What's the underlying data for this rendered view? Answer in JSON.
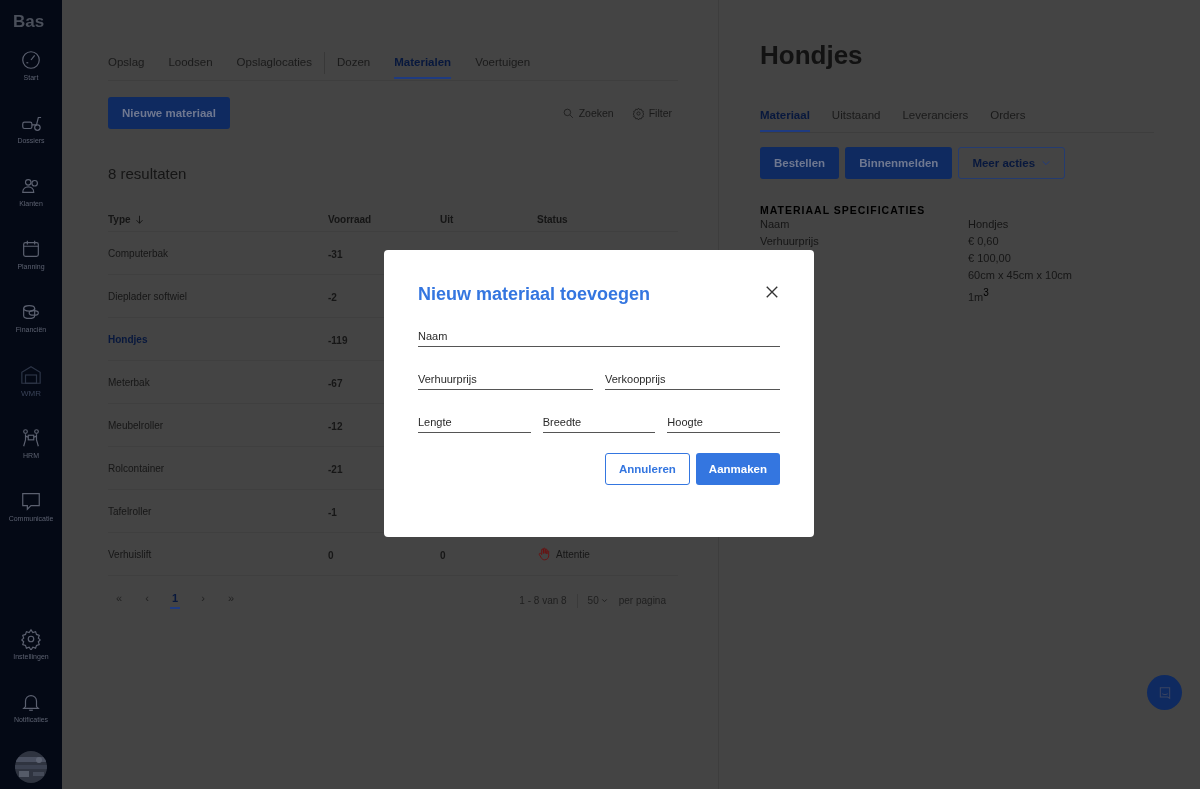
{
  "sidebar": {
    "logo": "Bas",
    "items": [
      {
        "label": "Start",
        "disabled": false
      },
      {
        "label": "Dossiers",
        "disabled": false
      },
      {
        "label": "Klanten",
        "disabled": false
      },
      {
        "label": "Planning",
        "disabled": false
      },
      {
        "label": "Financiën",
        "disabled": false
      },
      {
        "label": "WMR",
        "disabled": true
      },
      {
        "label": "HRM",
        "disabled": false
      },
      {
        "label": "Communicatie",
        "disabled": false
      }
    ],
    "bottom_items": [
      {
        "label": "Instellingen"
      },
      {
        "label": "Notificaties"
      }
    ]
  },
  "tabs": [
    {
      "label": "Opslag",
      "selected": false
    },
    {
      "label": "Loodsen",
      "selected": false
    },
    {
      "label": "Opslaglocaties",
      "selected": false
    },
    {
      "label": "Dozen",
      "selected": false
    },
    {
      "label": "Materialen",
      "selected": true
    },
    {
      "label": "Voertuigen",
      "selected": false
    }
  ],
  "new_button": "Nieuwe materiaal",
  "search": "Zoeken",
  "filter": "Filter",
  "result_count": "8 resultaten",
  "table": {
    "columns": [
      "Type",
      "Voorraad",
      "Uit",
      "Status"
    ],
    "rows": [
      {
        "type": "Computerbak",
        "voorraad": "-31",
        "selected": false
      },
      {
        "type": "Dieplader softwiel",
        "voorraad": "-2",
        "selected": false
      },
      {
        "type": "Hondjes",
        "voorraad": "-119",
        "selected": true
      },
      {
        "type": "Meterbak",
        "voorraad": "-67",
        "selected": false
      },
      {
        "type": "Meubelroller",
        "voorraad": "-12",
        "selected": false
      },
      {
        "type": "Rolcontainer",
        "voorraad": "-21",
        "selected": false
      },
      {
        "type": "Tafelroller",
        "voorraad": "-1",
        "selected": false
      },
      {
        "type": "Verhuislift",
        "voorraad": "0",
        "uit": "0",
        "status": {
          "label": "Attentie",
          "kind": "attention"
        },
        "selected": false
      }
    ]
  },
  "pagination": {
    "first": "«",
    "prev": "‹",
    "pages": [
      {
        "label": "1",
        "selected": true
      }
    ],
    "next": "›",
    "last": "»",
    "range": "1 - 8 van 8",
    "per_page": "50",
    "per_page_label": "per pagina"
  },
  "detail": {
    "title": "Hondjes",
    "tabs": [
      {
        "label": "Materiaal",
        "selected": true
      },
      {
        "label": "Uitstaand",
        "selected": false
      },
      {
        "label": "Leveranciers",
        "selected": false
      },
      {
        "label": "Orders",
        "selected": false
      }
    ],
    "actions": [
      {
        "label": "Bestellen",
        "kind": "primary"
      },
      {
        "label": "Binnenmelden",
        "kind": "primary"
      },
      {
        "label": "Meer acties",
        "kind": "dropdown"
      }
    ],
    "section": "MATERIAAL SPECIFICATIES",
    "specs": [
      {
        "label": "Naam",
        "value": "Hondjes"
      },
      {
        "label": "Verhuurprijs",
        "value": "€ 0,60"
      },
      {
        "value": "€ 100,00"
      },
      {
        "value": "60cm x 45cm x 10cm"
      },
      {
        "value": "1m$^{3}$"
      }
    ]
  },
  "modal": {
    "title": "Nieuw materiaal toevoegen",
    "field_rows": [
      [
        {
          "placeholder": "Naam"
        }
      ],
      [
        {
          "placeholder": "Verhuurprijs"
        },
        {
          "placeholder": "Verkoopprijs"
        }
      ],
      [
        {
          "placeholder": "Lengte"
        },
        {
          "placeholder": "Breedte"
        },
        {
          "placeholder": "Hoogte"
        }
      ]
    ],
    "cancel": "Annuleren",
    "submit": "Aanmaken"
  }
}
